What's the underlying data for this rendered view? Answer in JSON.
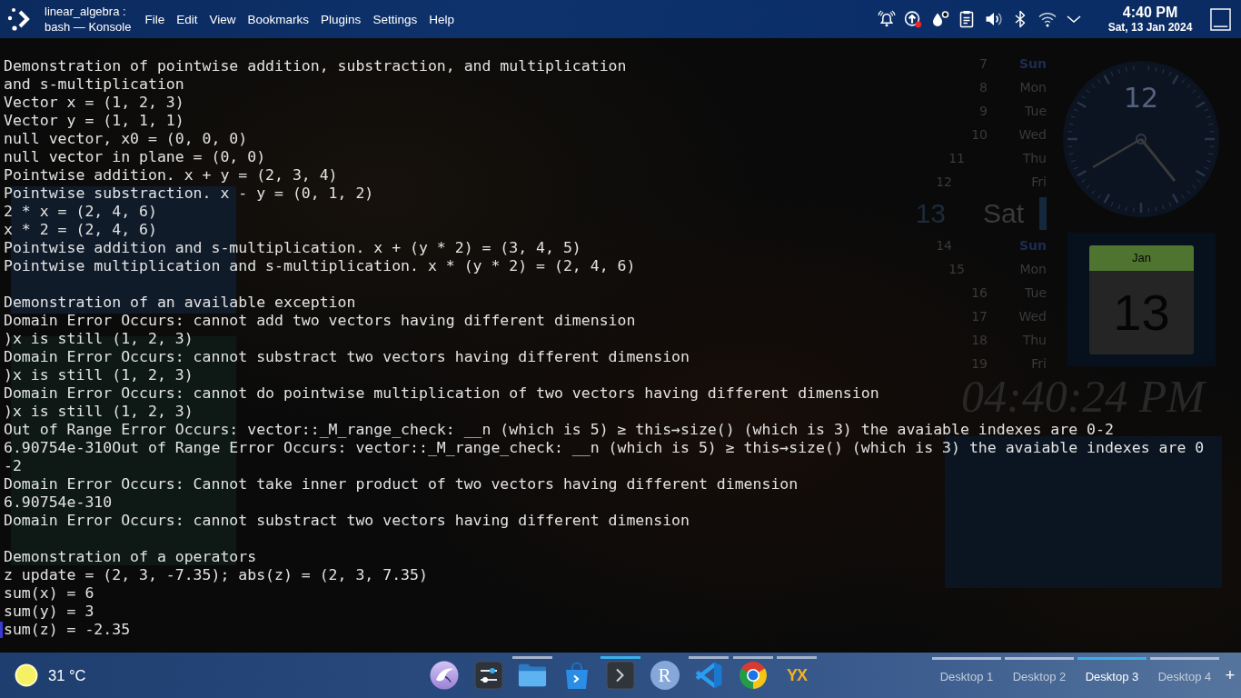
{
  "top_panel": {
    "title_lines": [
      "linear_algebra :",
      "bash — Konsole"
    ],
    "menu": [
      "File",
      "Edit",
      "View",
      "Bookmarks",
      "Plugins",
      "Settings",
      "Help"
    ],
    "tray": [
      {
        "kind": "alarm",
        "badge": false
      },
      {
        "kind": "update",
        "badge": true
      },
      {
        "kind": "drops",
        "badge": false
      },
      {
        "kind": "clipboard",
        "badge": false
      },
      {
        "kind": "volume",
        "badge": false
      },
      {
        "kind": "bluetooth",
        "badge": false
      },
      {
        "kind": "wifi",
        "badge": false
      },
      {
        "kind": "expand",
        "badge": false
      }
    ],
    "clock": {
      "time": "4:40 PM",
      "date": "Sat, 13 Jan 2024"
    }
  },
  "terminal": {
    "cursor": true,
    "sections": [
      [
        "Demonstration of pointwise addition, substraction, and multiplication",
        "and s-multiplication",
        "Vector x = (1, 2, 3)",
        "Vector y = (1, 1, 1)",
        "null vector, x0 = (0, 0, 0)",
        "null vector in plane = (0, 0)",
        "Pointwise addition. x + y = (2, 3, 4)",
        "Pointwise substraction. x - y = (0, 1, 2)",
        "2 * x = (2, 4, 6)",
        "x * 2 = (2, 4, 6)",
        "Pointwise addition and s-multiplication. x + (y * 2) = (3, 4, 5)",
        "Pointwise multiplication and s-multiplication. x * (y * 2) = (2, 4, 6)"
      ],
      [
        "Demonstration of an available exception",
        "Domain Error Occurs: cannot add two vectors having different dimension",
        ")x is still (1, 2, 3)",
        "Domain Error Occurs: cannot substract two vectors having different dimension",
        ")x is still (1, 2, 3)",
        "Domain Error Occurs: cannot do pointwise multiplication of two vectors having different dimension",
        ")x is still (1, 2, 3)",
        "Out of Range Error Occurs: vector::_M_range_check: __n (which is 5) ≥ this→size() (which is 3) the avaiable indexes are 0-2",
        "6.90754e-310Out of Range Error Occurs: vector::_M_range_check: __n (which is 5) ≥ this→size() (which is 3) the avaiable indexes are 0",
        "-2",
        "Domain Error Occurs: Cannot take inner product of two vectors having different dimension",
        "6.90754e-310",
        "Domain Error Occurs: cannot substract two vectors having different dimension"
      ],
      [
        "Demonstration of a operators",
        "z update = (2, 3, -7.35); abs(z) = (2, 3, 7.35)",
        "sum(x) = 6",
        "sum(y) = 3",
        "sum(z) = -2.35"
      ]
    ]
  },
  "desktop": {
    "calendar_strip": [
      {
        "day": "7",
        "weekday": "Sun",
        "accent": true,
        "selected": false
      },
      {
        "day": "8",
        "weekday": "Mon",
        "accent": false,
        "selected": false
      },
      {
        "day": "9",
        "weekday": "Tue",
        "accent": false,
        "selected": false
      },
      {
        "day": "10",
        "weekday": "Wed",
        "accent": false,
        "selected": false
      },
      {
        "day": "11",
        "weekday": "Thu",
        "accent": false,
        "selected": false
      },
      {
        "day": "12",
        "weekday": "Fri",
        "accent": false,
        "selected": false
      },
      {
        "day": "13",
        "weekday": "Sat",
        "accent": false,
        "selected": true
      },
      {
        "day": "14",
        "weekday": "Sun",
        "accent": true,
        "selected": false
      },
      {
        "day": "15",
        "weekday": "Mon",
        "accent": false,
        "selected": false
      },
      {
        "day": "16",
        "weekday": "Tue",
        "accent": false,
        "selected": false
      },
      {
        "day": "17",
        "weekday": "Wed",
        "accent": false,
        "selected": false
      },
      {
        "day": "18",
        "weekday": "Thu",
        "accent": false,
        "selected": false
      },
      {
        "day": "19",
        "weekday": "Fri",
        "accent": false,
        "selected": false
      }
    ],
    "analog_clock": {
      "numeral": "12"
    },
    "calendar_tile": {
      "month": "Jan",
      "day": "13"
    },
    "digital_clock": "04:40:24 PM"
  },
  "taskbar": {
    "weather": {
      "temperature": "31 °C"
    },
    "apps": [
      {
        "kind": "bird",
        "running": false,
        "selected": false
      },
      {
        "kind": "sliders",
        "running": false,
        "selected": false
      },
      {
        "kind": "folder",
        "running": true,
        "selected": false
      },
      {
        "kind": "bag",
        "running": false,
        "selected": false
      },
      {
        "kind": "terminal",
        "running": true,
        "selected": true
      },
      {
        "kind": "letter",
        "label": "R",
        "running": false,
        "selected": false
      },
      {
        "kind": "ribbon",
        "running": true,
        "selected": false
      },
      {
        "kind": "browser",
        "running": true,
        "selected": false
      },
      {
        "kind": "letters",
        "label": "YX",
        "running": true,
        "selected": false
      }
    ],
    "desktops": [
      {
        "label": "Desktop 1",
        "selected": false
      },
      {
        "label": "Desktop 2",
        "selected": false
      },
      {
        "label": "Desktop 3",
        "selected": true
      },
      {
        "label": "Desktop 4",
        "selected": false
      }
    ],
    "add_desktop": "+"
  }
}
